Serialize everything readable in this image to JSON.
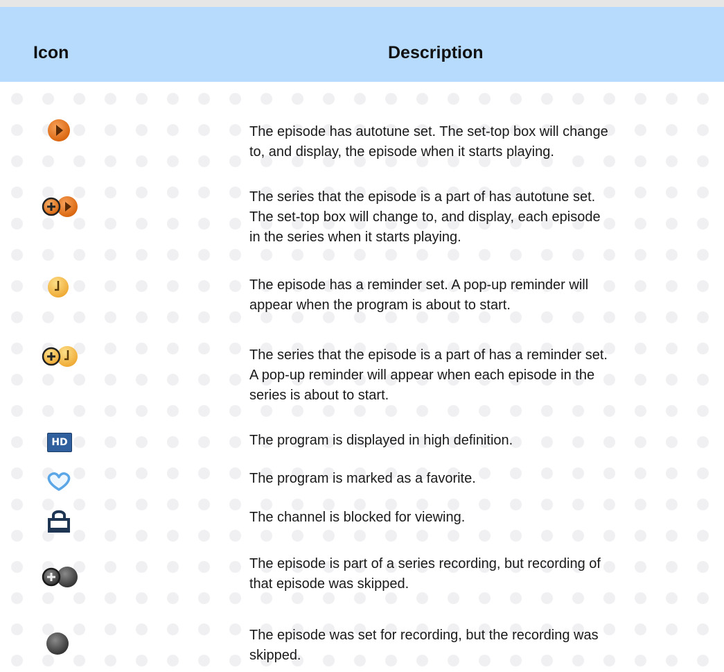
{
  "header": {
    "icon_col": "Icon",
    "desc_col": "Description"
  },
  "rows": [
    {
      "icon": "autotune-episode-icon",
      "lines": [
        "The episode has autotune set. The set-top box will change",
        "to, and display, the episode when it starts playing."
      ]
    },
    {
      "icon": "autotune-series-icon",
      "lines": [
        "The series that the episode is a part of has autotune set.",
        "The set-top box will change to, and display, each episode",
        "in the series when it starts playing."
      ]
    },
    {
      "icon": "reminder-episode-icon",
      "lines": [
        "The episode has a reminder set. A pop-up reminder will",
        "appear when the program is about to start."
      ]
    },
    {
      "icon": "reminder-series-icon",
      "lines": [
        "The series that the episode is a part of has a reminder set.",
        "A pop-up reminder will appear when each episode in the",
        "series is about to start."
      ]
    },
    {
      "icon": "hd-icon",
      "icon_text": "HD",
      "lines": [
        "The program is displayed in high definition."
      ]
    },
    {
      "icon": "heart-icon",
      "lines": [
        "The program is marked as a favorite."
      ]
    },
    {
      "icon": "lock-icon",
      "lines": [
        "The channel is blocked for viewing."
      ]
    },
    {
      "icon": "series-record-skipped-icon",
      "lines": [
        "The episode is part of a series recording, but recording of",
        "that episode was skipped."
      ]
    },
    {
      "icon": "record-skipped-icon",
      "lines": [
        "The episode was set for recording, but the recording was",
        "skipped."
      ]
    }
  ],
  "colors": {
    "header_bg": "#b7dbfd",
    "autotune_orange": "#e8761c",
    "reminder_yellow": "#f6c24a",
    "hd_blue": "#2f5f9c",
    "heart_blue": "#5aa6e6",
    "lock_navy": "#1f3554",
    "record_gray": "#4a4a4a"
  }
}
